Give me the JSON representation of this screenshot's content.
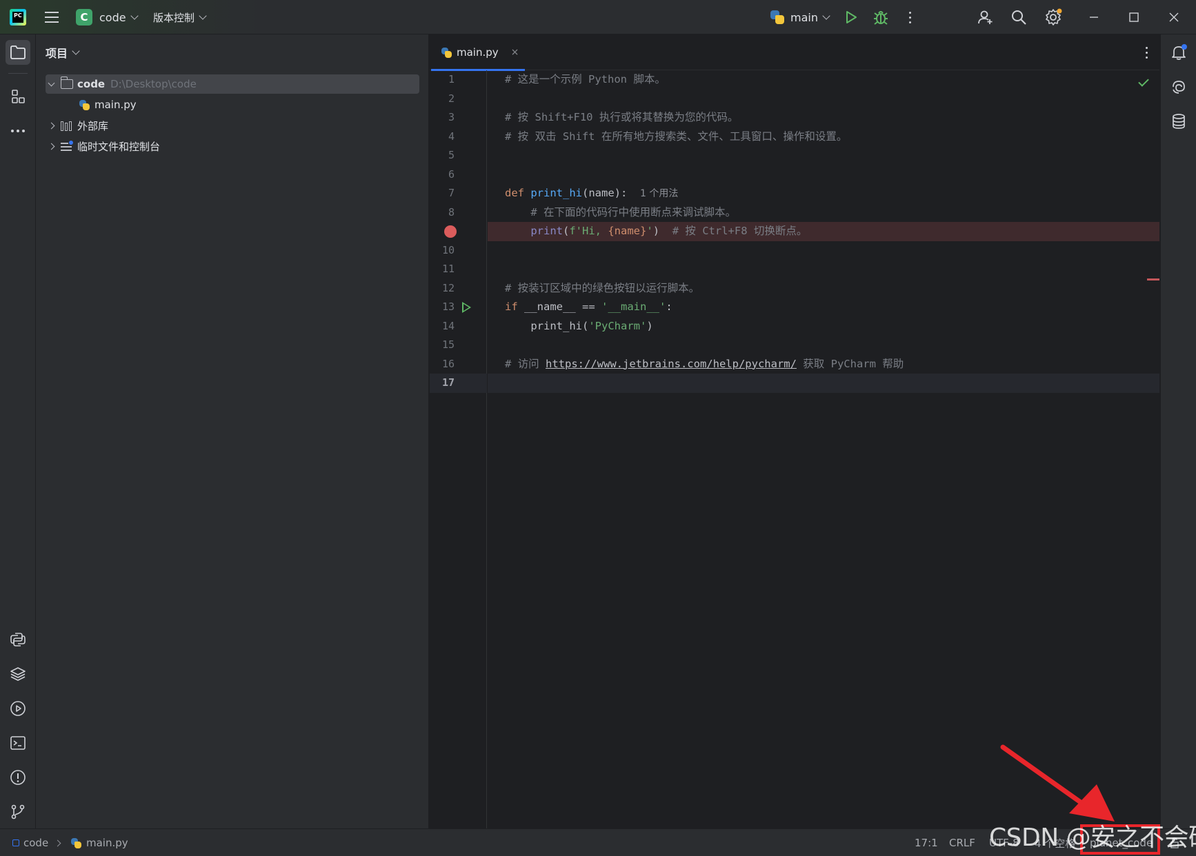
{
  "titlebar": {
    "project_badge": "C",
    "project_name": "code",
    "vcs_label": "版本控制",
    "run_config": "main",
    "icons": [
      "pycharm-logo",
      "hamburger-menu-icon",
      "run-icon",
      "debug-icon",
      "more-icon",
      "add-user-icon",
      "search-icon",
      "settings-icon",
      "minimize-icon",
      "maximize-icon",
      "close-icon"
    ]
  },
  "left_strip": {
    "icons": [
      "project-folder-icon",
      "structure-icon",
      "more-tools-icon",
      "python-console-icon",
      "python-packages-icon",
      "services-icon",
      "terminal-icon",
      "problems-icon",
      "git-icon"
    ]
  },
  "project_panel": {
    "header": "项目",
    "tree": [
      {
        "name": "code",
        "path": "D:\\Desktop\\code"
      },
      {
        "name": "main.py"
      },
      {
        "name": "外部库"
      },
      {
        "name": "临时文件和控制台"
      }
    ]
  },
  "editor": {
    "tab": {
      "label": "main.py",
      "close": "×"
    },
    "line_numbers": [
      "1",
      "2",
      "3",
      "4",
      "5",
      "6",
      "7",
      "8",
      "",
      "10",
      "11",
      "12",
      "13",
      "14",
      "15",
      "16",
      "17"
    ],
    "code": {
      "l1": "# 这是一个示例 Python 脚本。",
      "l3": "# 按 Shift+F10 执行或将其替换为您的代码。",
      "l4": "# 按 双击 Shift 在所有地方搜索类、文件、工具窗口、操作和设置。",
      "l7_def": "def",
      "l7_fn": "print_hi",
      "l7_rest": "(name):",
      "l7_hint": "1 个用法",
      "l8": "# 在下面的代码行中使用断点来调试脚本。",
      "l9_fn": "print",
      "l9_paren": "(",
      "l9_str1": "f'Hi, ",
      "l9_expr": "{name}",
      "l9_str2": "'",
      "l9_close": ")",
      "l9_comment": "# 按 Ctrl+F8 切换断点。",
      "l12": "# 按装订区域中的绿色按钮以运行脚本。",
      "l13_if": "if",
      "l13_mid": " __name__ == ",
      "l13_str": "'__main__'",
      "l13_colon": ":",
      "l14_fn": "print_hi(",
      "l14_str": "'PyCharm'",
      "l14_close": ")",
      "l16_pre": "# 访问 ",
      "l16_link": "https://www.jetbrains.com/help/pycharm/",
      "l16_post": " 获取 PyCharm 帮助"
    }
  },
  "right_strip": {
    "icons": [
      "notifications-icon",
      "ai-assistant-icon",
      "database-icon"
    ]
  },
  "statusbar": {
    "breadcrumb_project": "code",
    "breadcrumb_file": "main.py",
    "position": "17:1",
    "line_sep": "CRLF",
    "encoding": "UTF-8",
    "indent": "4 个空格",
    "interpreter": "planet_code"
  },
  "watermark": "CSDN @安之不会码",
  "colors": {
    "accent": "#3574f0",
    "breakpoint": "#db5c5c",
    "run_green": "#5fb865",
    "annotation_red": "#e8262b"
  }
}
